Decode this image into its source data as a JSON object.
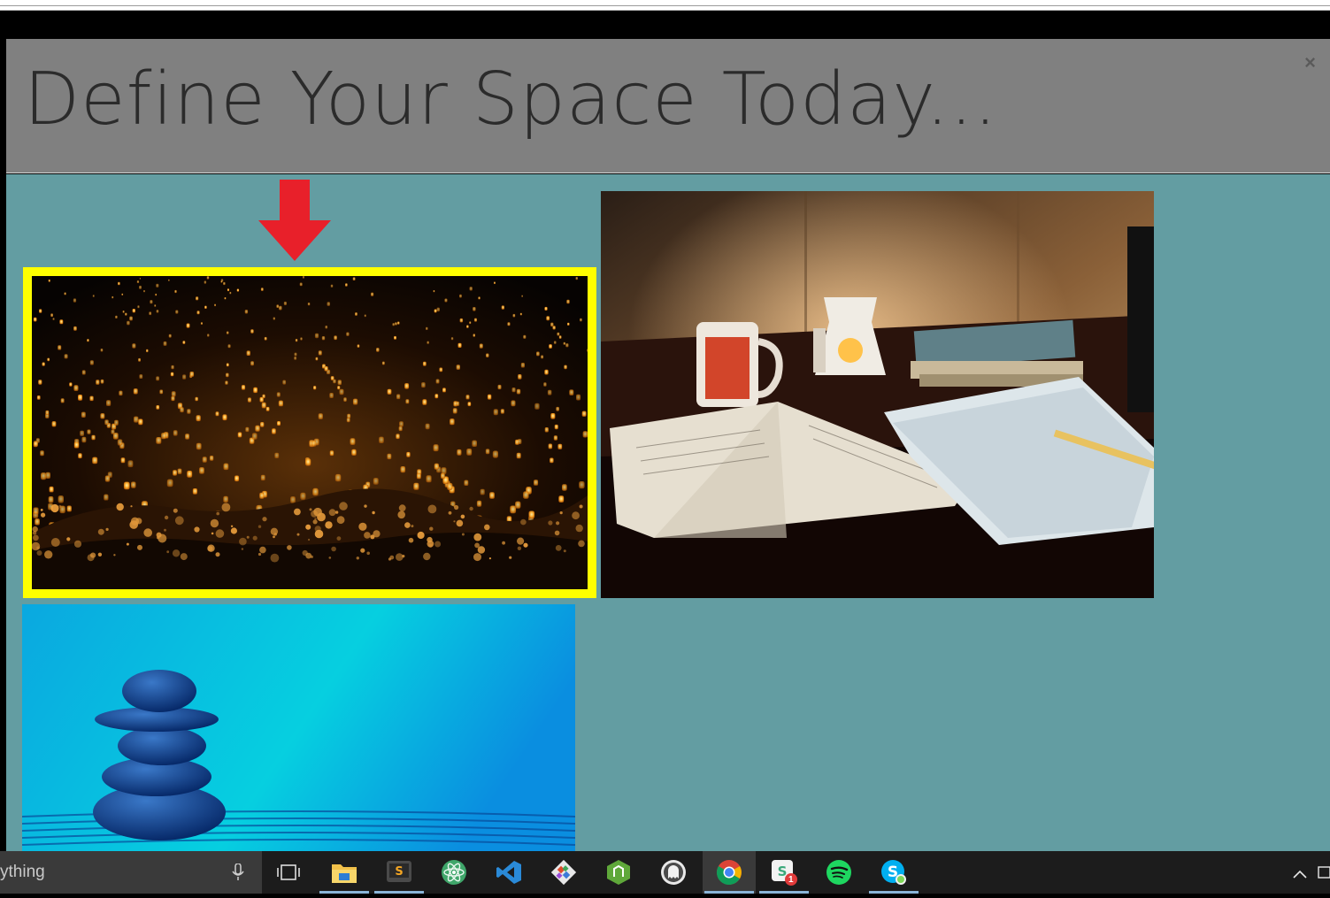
{
  "modal": {
    "title": "Define Your Space Today...",
    "close_label": "×"
  },
  "gallery": {
    "images": [
      {
        "name": "sky-lanterns-photo",
        "selected": true
      },
      {
        "name": "desk-notebooks-photo",
        "selected": false
      },
      {
        "name": "zen-stones-photo",
        "selected": false
      }
    ],
    "selection_color": "#ffff00",
    "arrow_color": "#e8202a"
  },
  "taskbar": {
    "search_text": "ything",
    "icons": [
      "task-view-icon",
      "file-explorer-icon",
      "sublime-text-icon",
      "atom-icon",
      "visual-studio-code-icon",
      "git-icon",
      "node-icon",
      "ghost-icon",
      "chrome-icon",
      "slack-icon",
      "spotify-icon",
      "skype-icon"
    ],
    "slack_badge": "1"
  },
  "colors": {
    "header_bg": "#808080",
    "body_bg": "#639da2",
    "taskbar_bg": "#1c1c1c"
  }
}
